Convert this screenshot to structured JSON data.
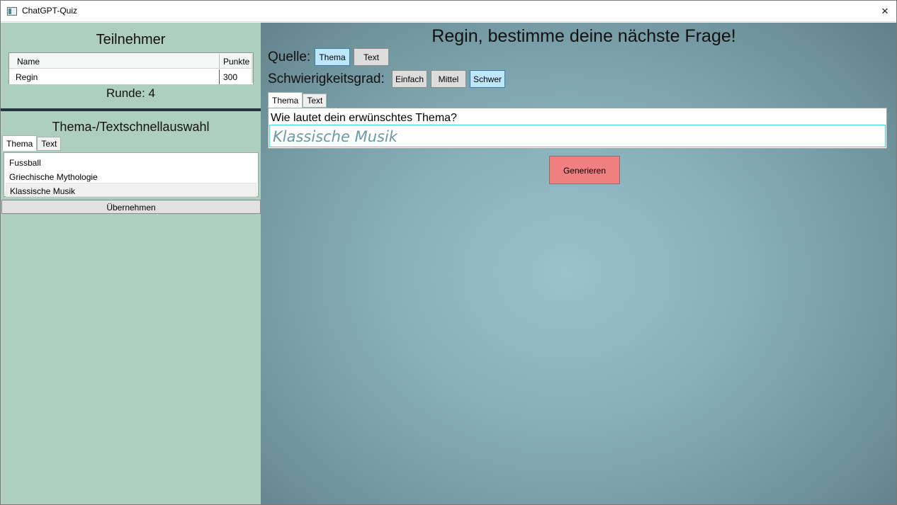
{
  "window": {
    "title": "ChatGPT-Quiz",
    "close_icon": "×"
  },
  "left": {
    "participants_heading": "Teilnehmer",
    "grid": {
      "columns": [
        "Name",
        "Punkte"
      ],
      "rows": [
        {
          "name": "Regin",
          "points": "300"
        }
      ]
    },
    "round_label": "Runde: 4",
    "quick_heading": "Thema-/Textschnellauswahl",
    "tabs": [
      "Thema",
      "Text"
    ],
    "active_tab": "Thema",
    "items": [
      "Fussball",
      "Griechische Mythologie",
      "Klassische Musik"
    ],
    "selected_item": "Klassische Musik",
    "apply_label": "Übernehmen"
  },
  "right": {
    "heading": "Regin, bestimme deine nächste Frage!",
    "source_label": "Quelle:",
    "source_options": [
      "Thema",
      "Text"
    ],
    "source_selected": "Thema",
    "difficulty_label": "Schwierigkeitsgrad:",
    "difficulty_options": [
      "Einfach",
      "Mittel",
      "Schwer"
    ],
    "difficulty_selected": "Schwer",
    "tabs": [
      "Thema",
      "Text"
    ],
    "active_tab": "Thema",
    "question": "Wie lautet dein erwünschtes Thema?",
    "topic_placeholder": "Klassische Musik",
    "generate_label": "Generieren"
  },
  "colors": {
    "left_panel": "#aecfc0",
    "selected_option": "#bee6fd",
    "generate_button": "#f08080",
    "input_border": "#36d5e3"
  }
}
